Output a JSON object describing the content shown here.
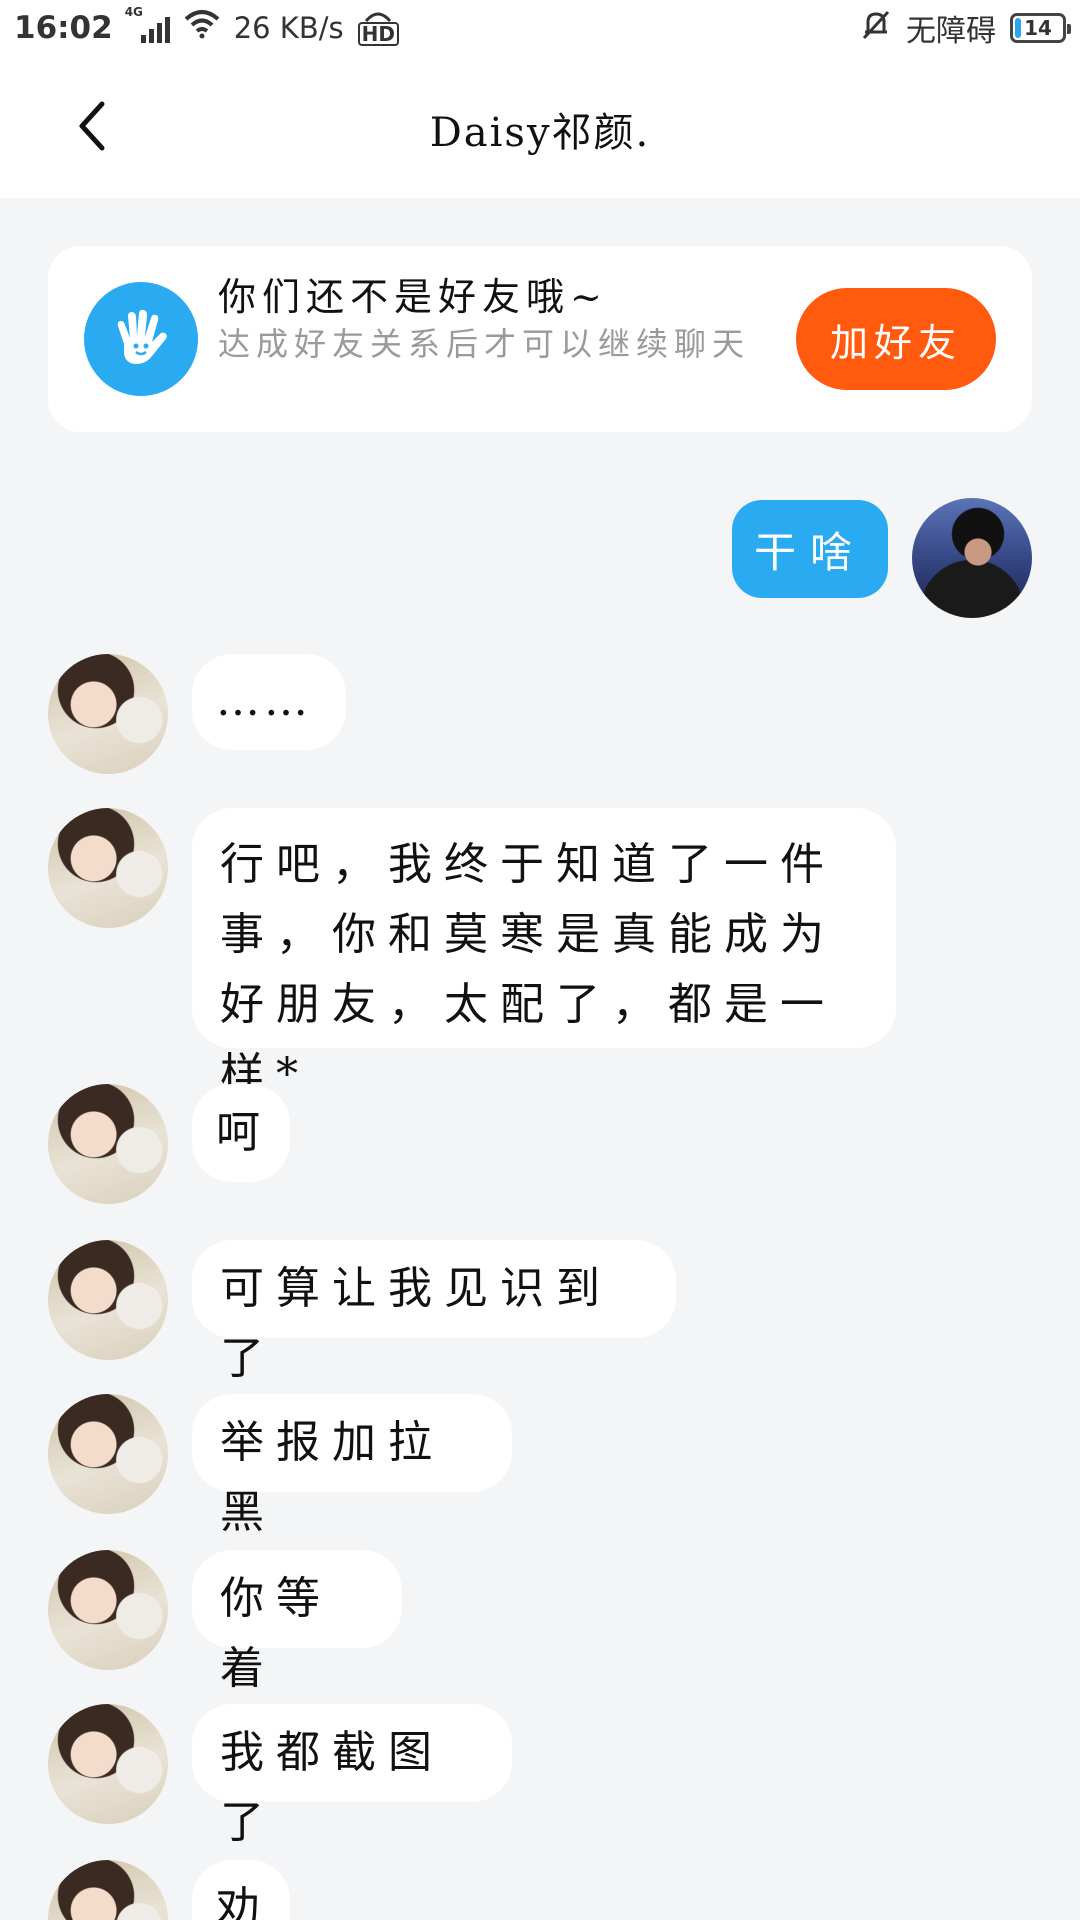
{
  "status_bar": {
    "time": "16:02",
    "network": "4G",
    "speed": "26 KB/s",
    "hd": "HD",
    "accessibility": "无障碍",
    "battery": "14",
    "battery_level_percent": 14
  },
  "header": {
    "title": "Daisy祁颜."
  },
  "friend_card": {
    "title": "你们还不是好友哦~",
    "subtitle": "达成好友关系后才可以继续聊天",
    "button": "加好友",
    "icon": "waving-hand-icon"
  },
  "messages": [
    {
      "sender": "me",
      "text": "干啥"
    },
    {
      "sender": "other",
      "text": "……"
    },
    {
      "sender": "other",
      "text": "行吧，我终于知道了一件事，你和莫寒是真能成为好朋友，太配了，都是一样*"
    },
    {
      "sender": "other",
      "text": "呵"
    },
    {
      "sender": "other",
      "text": "可算让我见识到了"
    },
    {
      "sender": "other",
      "text": "举报加拉黑"
    },
    {
      "sender": "other",
      "text": "你等着"
    },
    {
      "sender": "other",
      "text": "我都截图了"
    },
    {
      "sender": "other",
      "text": "劝"
    }
  ],
  "colors": {
    "accent_blue": "#2aaaf0",
    "add_friend_orange": "#ff5a0e",
    "background": "#f4f5f7"
  }
}
